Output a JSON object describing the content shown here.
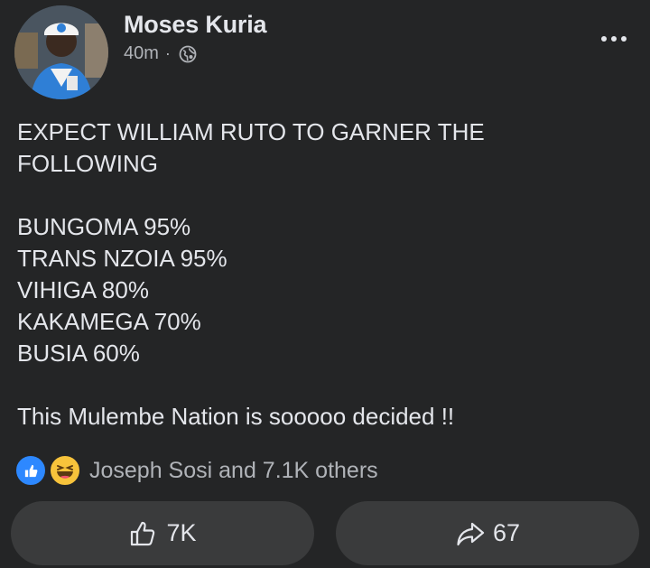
{
  "post": {
    "author": "Moses Kuria",
    "time": "40m",
    "separator": "·",
    "audience_icon": "globe-icon",
    "lines": [
      "EXPECT WILLIAM RUTO TO GARNER THE",
      "FOLLOWING",
      "",
      "BUNGOMA 95%",
      "TRANS NZOIA 95%",
      "VIHIGA 80%",
      "KAKAMEGA 70%",
      "BUSIA 60%",
      "",
      "This Mulembe Nation is sooooo decided !!"
    ],
    "reactions": {
      "icons": [
        "like-icon",
        "haha-icon"
      ],
      "text": "Joseph Sosi and 7.1K others"
    },
    "actions": {
      "like_count": "7K",
      "share_count": "67"
    }
  },
  "colors": {
    "background": "#242526",
    "button_bg": "#3a3b3c",
    "text_primary": "#e4e6eb",
    "text_secondary": "#b0b3b8",
    "like_blue": "#2d88ff",
    "haha_yellow": "#f7c33b"
  }
}
